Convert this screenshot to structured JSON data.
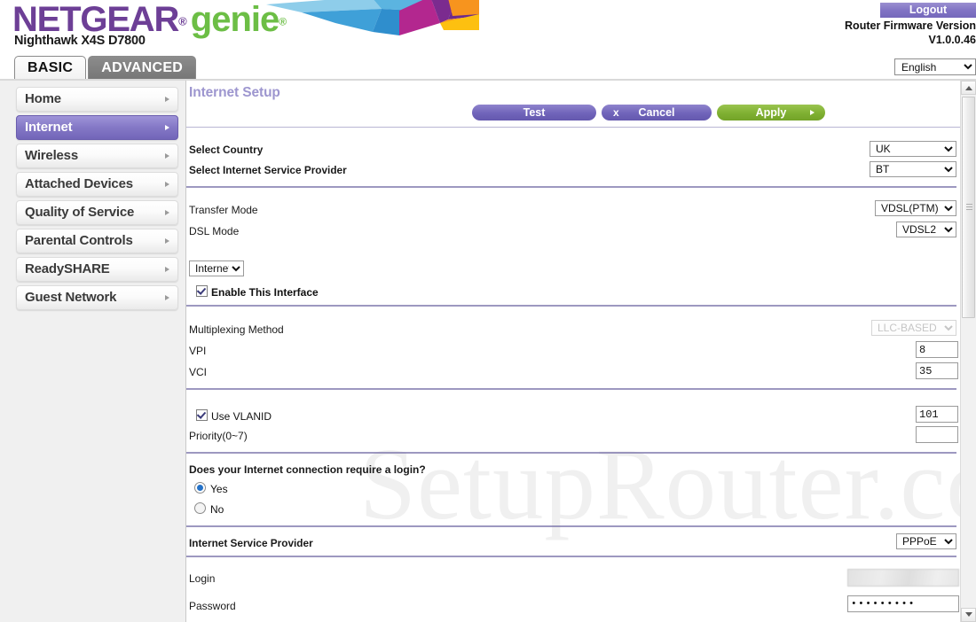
{
  "header": {
    "brand_primary": "NETGEAR",
    "brand_secondary": "genie",
    "registered_mark": "®",
    "model": "Nighthawk X4S D7800",
    "logout_label": "Logout",
    "firmware_label": "Router Firmware Version",
    "firmware_version": "V1.0.0.46",
    "language_selected": "English",
    "language_options": [
      "English"
    ]
  },
  "tabs": [
    {
      "label": "BASIC",
      "active": true
    },
    {
      "label": "ADVANCED",
      "active": false
    }
  ],
  "sidebar": {
    "items": [
      {
        "label": "Home",
        "selected": false
      },
      {
        "label": "Internet",
        "selected": true
      },
      {
        "label": "Wireless",
        "selected": false
      },
      {
        "label": "Attached Devices",
        "selected": false
      },
      {
        "label": "Quality of Service",
        "selected": false
      },
      {
        "label": "Parental Controls",
        "selected": false
      },
      {
        "label": "ReadySHARE",
        "selected": false
      },
      {
        "label": "Guest Network",
        "selected": false
      }
    ]
  },
  "main": {
    "page_title": "Internet Setup",
    "watermark": "SetupRouter.co",
    "buttons": {
      "test": "Test",
      "cancel": "Cancel",
      "cancel_icon": "x",
      "apply": "Apply"
    },
    "fields": {
      "select_country_label": "Select Country",
      "select_country_value": "UK",
      "select_isp_label": "Select Internet Service Provider",
      "select_isp_value": "BT",
      "transfer_mode_label": "Transfer Mode",
      "transfer_mode_value": "VDSL(PTM)",
      "dsl_mode_label": "DSL Mode",
      "dsl_mode_value": "VDSL2",
      "interface_value": "Internet",
      "enable_interface_label": "Enable This Interface",
      "multiplexing_label": "Multiplexing Method",
      "multiplexing_value": "LLC-BASED",
      "vpi_label": "VPI",
      "vpi_value": "8",
      "vci_label": "VCI",
      "vci_value": "35",
      "use_vlanid_label": "Use VLANID",
      "vlanid_value": "101",
      "priority_label": "Priority(0~7)",
      "priority_value": "",
      "login_question": "Does your Internet connection require a login?",
      "login_yes": "Yes",
      "login_no": "No",
      "isp_label": "Internet Service Provider",
      "isp_value": "PPPoE",
      "login_field_label": "Login",
      "login_field_value": "",
      "password_label": "Password",
      "password_value": "•••••••••"
    }
  },
  "colors": {
    "brand_purple": "#6d3f96",
    "brand_green": "#6cbe45",
    "accent_purple": "#7064ba",
    "apply_green": "#7fb032",
    "title_lavender": "#9d96cf",
    "divider": "#7c75ab"
  }
}
